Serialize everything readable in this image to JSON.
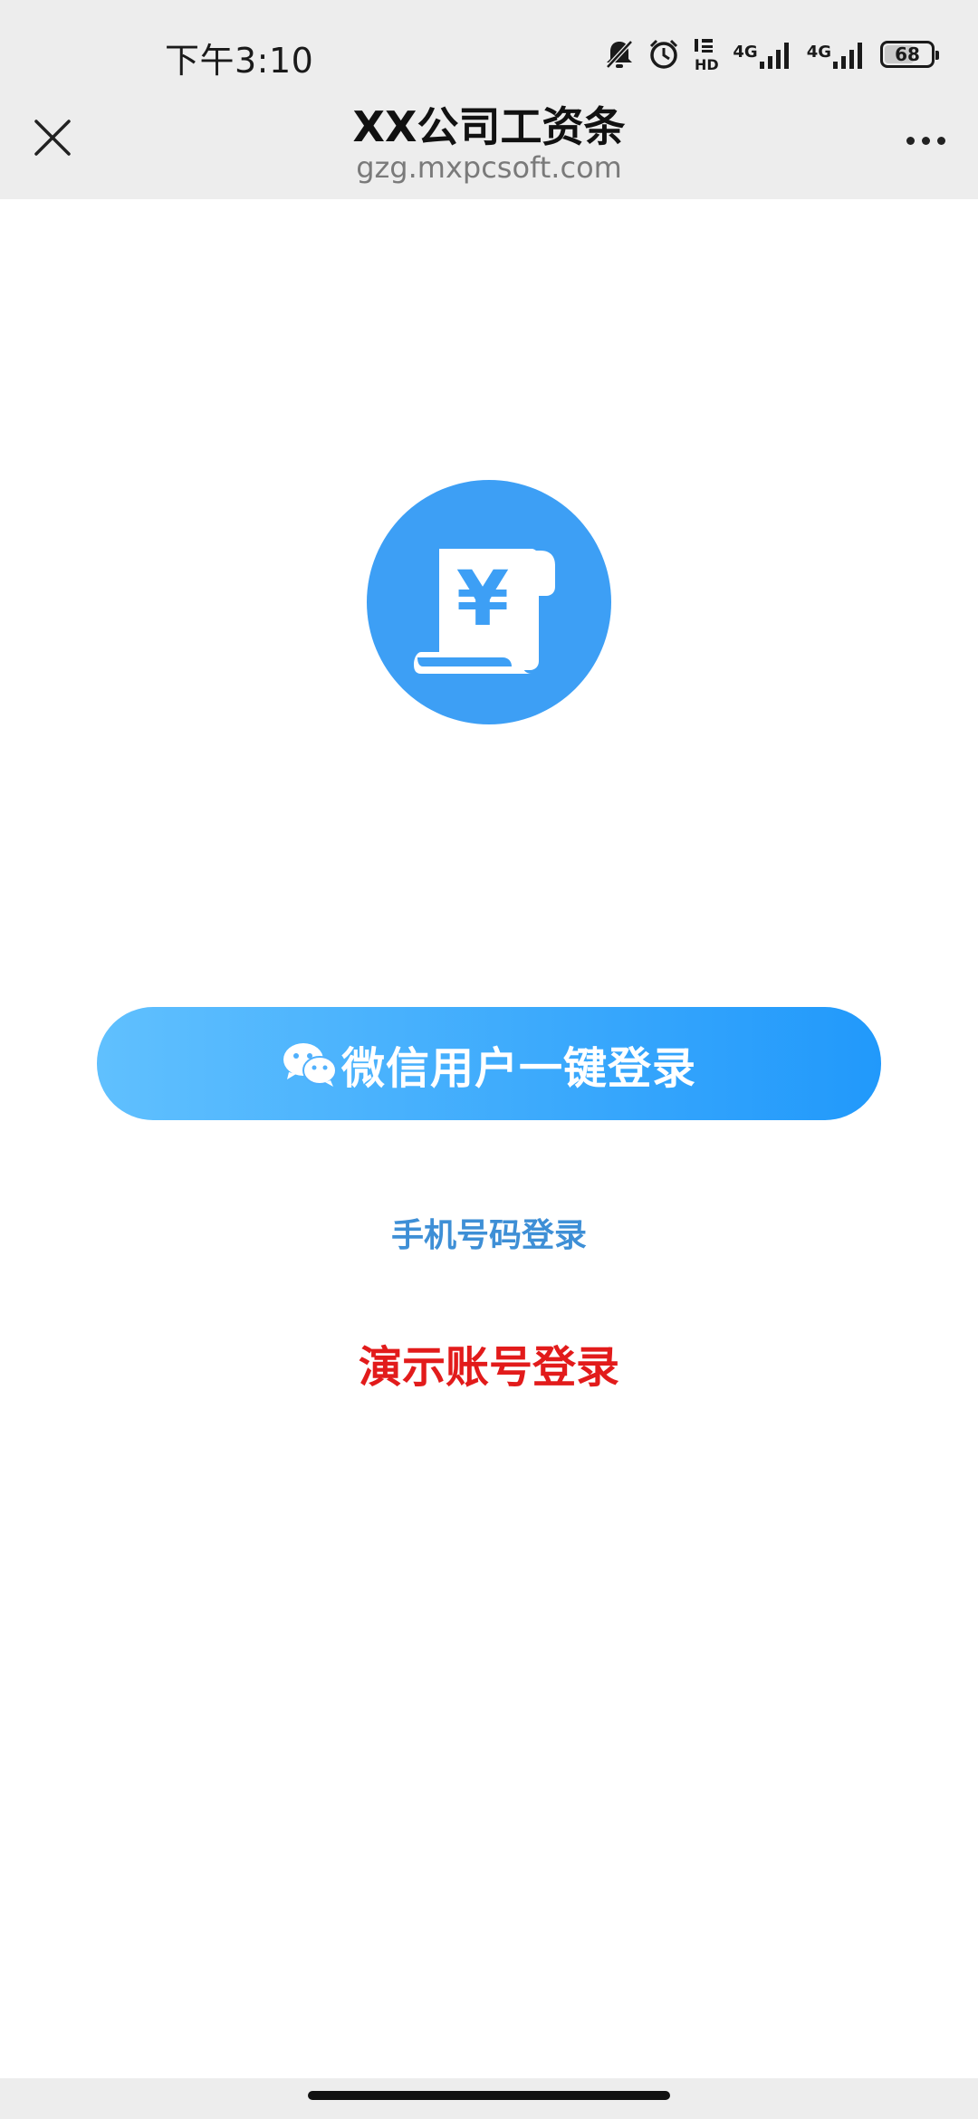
{
  "status_bar": {
    "time": "下午3:10",
    "hd_label": "HD",
    "net1_label": "4G",
    "net2_label": "4G",
    "battery_level": 68,
    "battery_text": "68"
  },
  "title_bar": {
    "title": "XX公司工资条",
    "url": "gzg.mxpcsoft.com"
  },
  "logo": {
    "symbol": "¥",
    "color": "#3d9ff5"
  },
  "actions": {
    "wechat_login_label": "微信用户一键登录",
    "phone_login_label": "手机号码登录",
    "demo_login_label": "演示账号登录"
  },
  "colors": {
    "accent": "#2199fb",
    "link": "#3e8fd6",
    "demo": "#e21b1b"
  }
}
